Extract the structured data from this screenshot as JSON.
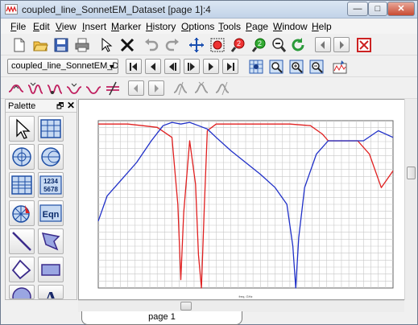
{
  "window": {
    "title": "coupled_line_SonnetEM_Dataset [page 1]:4",
    "minimize_label": "—",
    "maximize_label": "□",
    "close_label": "✕"
  },
  "menu": {
    "items": [
      {
        "underline": "F",
        "rest": "ile"
      },
      {
        "underline": "E",
        "rest": "dit"
      },
      {
        "underline": "V",
        "rest": "iew"
      },
      {
        "underline": "I",
        "rest": "nsert"
      },
      {
        "underline": "M",
        "rest": "arker"
      },
      {
        "underline": "H",
        "rest": "istory"
      },
      {
        "underline": "O",
        "rest": "ptions"
      },
      {
        "underline": "T",
        "rest": "ools"
      },
      {
        "underline": "P",
        "rest": "age"
      },
      {
        "underline": "W",
        "rest": "indow"
      },
      {
        "underline": "H",
        "rest": "elp"
      }
    ]
  },
  "toolbar2": {
    "dataset_value": "coupled_line_SonnetEM_Data"
  },
  "palette": {
    "title": "Palette",
    "float_label": "🗗",
    "close_label": "✕",
    "table_button_text": [
      "1234",
      "5678"
    ],
    "eqn_label": "Eqn",
    "text_label": "A"
  },
  "tabs": {
    "page_label": "page 1"
  },
  "chart_data": {
    "type": "line",
    "title": "",
    "xlabel": "freq, GHz",
    "ylabel": "",
    "grid": true,
    "series": [
      {
        "color": "#e02020",
        "note_shape": "reflection-like trace",
        "x": [
          0.0,
          0.05,
          0.1,
          0.15,
          0.2,
          0.25,
          0.27,
          0.28,
          0.29,
          0.31,
          0.33,
          0.34,
          0.35,
          0.36,
          0.37,
          0.4,
          0.45,
          0.55,
          0.65,
          0.72,
          0.76,
          0.78,
          0.8,
          0.83,
          0.88,
          0.92,
          0.96,
          1.0
        ],
        "values": [
          0.98,
          0.98,
          0.98,
          0.97,
          0.96,
          0.9,
          0.5,
          0.05,
          0.45,
          0.88,
          0.62,
          0.2,
          0.0,
          0.5,
          0.94,
          0.98,
          0.98,
          0.98,
          0.98,
          0.97,
          0.92,
          0.88,
          0.88,
          0.88,
          0.88,
          0.8,
          0.6,
          0.7
        ]
      },
      {
        "color": "#2030c8",
        "note_shape": "transmission-like trace",
        "x": [
          0.0,
          0.03,
          0.08,
          0.13,
          0.18,
          0.22,
          0.25,
          0.28,
          0.31,
          0.34,
          0.37,
          0.4,
          0.45,
          0.5,
          0.55,
          0.6,
          0.64,
          0.66,
          0.67,
          0.68,
          0.7,
          0.74,
          0.78,
          0.8,
          0.85,
          0.9,
          0.95,
          1.0
        ],
        "values": [
          0.4,
          0.55,
          0.65,
          0.75,
          0.88,
          0.97,
          0.99,
          0.98,
          0.99,
          0.97,
          0.95,
          0.9,
          0.82,
          0.75,
          0.68,
          0.6,
          0.5,
          0.25,
          0.0,
          0.3,
          0.6,
          0.8,
          0.88,
          0.88,
          0.88,
          0.88,
          0.94,
          0.9
        ]
      }
    ]
  }
}
